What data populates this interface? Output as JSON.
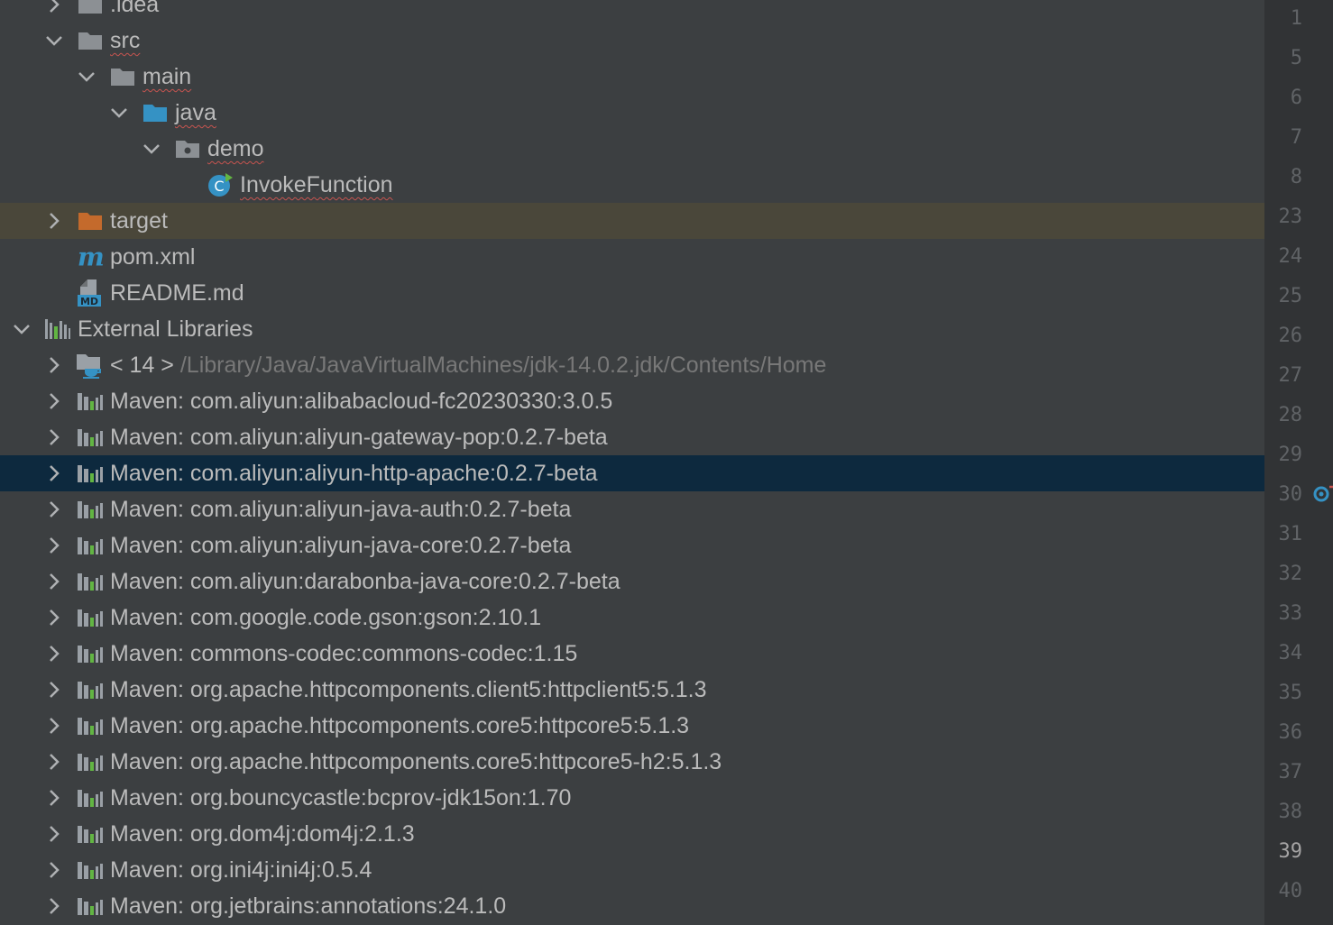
{
  "tree": [
    {
      "indent": 1,
      "expand": "collapsed",
      "icon": "folder-icon",
      "label": ".idea"
    },
    {
      "indent": 1,
      "expand": "expanded",
      "icon": "folder-icon",
      "label": "src",
      "squiggle": true
    },
    {
      "indent": 2,
      "expand": "expanded",
      "icon": "folder-icon",
      "label": "main",
      "squiggle": true
    },
    {
      "indent": 3,
      "expand": "expanded",
      "icon": "source-folder-icon",
      "label": "java",
      "squiggle": true
    },
    {
      "indent": 4,
      "expand": "expanded",
      "icon": "package-icon",
      "label": "demo",
      "squiggle": true
    },
    {
      "indent": 5,
      "expand": "none",
      "icon": "java-class-icon",
      "label": "InvokeFunction",
      "squiggle": true
    },
    {
      "indent": 1,
      "expand": "collapsed",
      "icon": "excluded-folder-icon",
      "label": "target",
      "highlight": "excluded"
    },
    {
      "indent": 1,
      "expand": "none",
      "icon": "maven-icon",
      "label": "pom.xml"
    },
    {
      "indent": 1,
      "expand": "none",
      "icon": "markdown-icon",
      "label": "README.md"
    },
    {
      "indent": 0,
      "expand": "expanded",
      "icon": "libraries-icon",
      "label": "External Libraries"
    },
    {
      "indent": 1,
      "expand": "collapsed",
      "icon": "jdk-icon",
      "label": "< 14 >",
      "path": "/Library/Java/JavaVirtualMachines/jdk-14.0.2.jdk/Contents/Home"
    },
    {
      "indent": 1,
      "expand": "collapsed",
      "icon": "library-icon",
      "label": "Maven: com.aliyun:alibabacloud-fc20230330:3.0.5"
    },
    {
      "indent": 1,
      "expand": "collapsed",
      "icon": "library-icon",
      "label": "Maven: com.aliyun:aliyun-gateway-pop:0.2.7-beta"
    },
    {
      "indent": 1,
      "expand": "collapsed",
      "icon": "library-icon",
      "label": "Maven: com.aliyun:aliyun-http-apache:0.2.7-beta",
      "highlight": "selected"
    },
    {
      "indent": 1,
      "expand": "collapsed",
      "icon": "library-icon",
      "label": "Maven: com.aliyun:aliyun-java-auth:0.2.7-beta"
    },
    {
      "indent": 1,
      "expand": "collapsed",
      "icon": "library-icon",
      "label": "Maven: com.aliyun:aliyun-java-core:0.2.7-beta"
    },
    {
      "indent": 1,
      "expand": "collapsed",
      "icon": "library-icon",
      "label": "Maven: com.aliyun:darabonba-java-core:0.2.7-beta"
    },
    {
      "indent": 1,
      "expand": "collapsed",
      "icon": "library-icon",
      "label": "Maven: com.google.code.gson:gson:2.10.1"
    },
    {
      "indent": 1,
      "expand": "collapsed",
      "icon": "library-icon",
      "label": "Maven: commons-codec:commons-codec:1.15"
    },
    {
      "indent": 1,
      "expand": "collapsed",
      "icon": "library-icon",
      "label": "Maven: org.apache.httpcomponents.client5:httpclient5:5.1.3"
    },
    {
      "indent": 1,
      "expand": "collapsed",
      "icon": "library-icon",
      "label": "Maven: org.apache.httpcomponents.core5:httpcore5:5.1.3"
    },
    {
      "indent": 1,
      "expand": "collapsed",
      "icon": "library-icon",
      "label": "Maven: org.apache.httpcomponents.core5:httpcore5-h2:5.1.3"
    },
    {
      "indent": 1,
      "expand": "collapsed",
      "icon": "library-icon",
      "label": "Maven: org.bouncycastle:bcprov-jdk15on:1.70"
    },
    {
      "indent": 1,
      "expand": "collapsed",
      "icon": "library-icon",
      "label": "Maven: org.dom4j:dom4j:2.1.3"
    },
    {
      "indent": 1,
      "expand": "collapsed",
      "icon": "library-icon",
      "label": "Maven: org.ini4j:ini4j:0.5.4"
    },
    {
      "indent": 1,
      "expand": "collapsed",
      "icon": "library-icon",
      "label": "Maven: org.jetbrains:annotations:24.1.0"
    }
  ],
  "gutter": {
    "line_numbers": [
      "1",
      "5",
      "6",
      "7",
      "8",
      "23",
      "24",
      "25",
      "26",
      "27",
      "28",
      "29",
      "30",
      "31",
      "32",
      "33",
      "34",
      "35",
      "36",
      "37",
      "38",
      "39",
      "40"
    ],
    "current_line": "39",
    "marker_line": "30",
    "marker_icon": "implementation-marker-icon"
  },
  "colors": {
    "background": "#3c3f41",
    "gutter_background": "#313335",
    "selected_row": "#0d293e",
    "excluded_row": "#4a473a",
    "folder": "#8c9094",
    "source_folder": "#3592c4",
    "excluded_folder": "#c46a2c",
    "error_squiggle": "#c75450"
  }
}
